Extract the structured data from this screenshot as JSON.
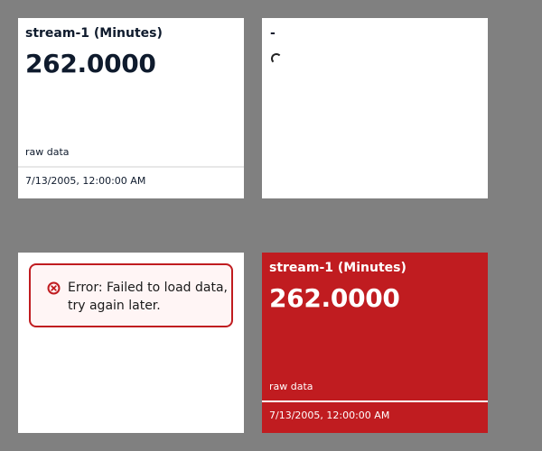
{
  "cards": [
    {
      "title": "stream-1 (Minutes)",
      "value": "262.0000",
      "subtitle": "raw data",
      "timestamp": "7/13/2005, 12:00:00 AM"
    },
    {
      "placeholder": "-",
      "loading_icon": "spinner-icon"
    },
    {
      "error_message": "Error: Failed to load data, try again later.",
      "error_icon": "error-circle-icon"
    },
    {
      "title": "stream-1 (Minutes)",
      "value": "262.0000",
      "subtitle": "raw data",
      "timestamp": "7/13/2005, 12:00:00 AM",
      "alert_color": "#c01c20"
    }
  ],
  "colors": {
    "background": "#808080",
    "card": "#ffffff",
    "alert": "#c01c20",
    "text": "#0f1b2d"
  }
}
